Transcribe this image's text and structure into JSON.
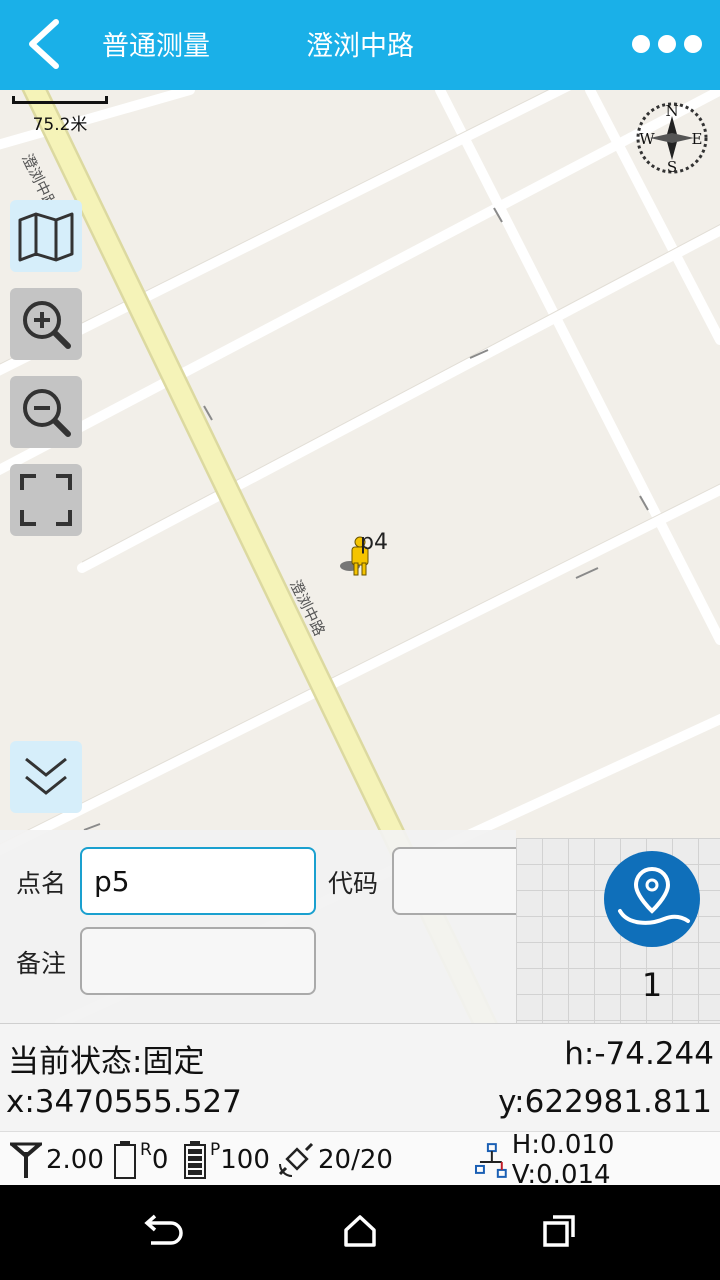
{
  "header": {
    "back_icon": "chevron-left-icon",
    "mode_title": "普通测量",
    "road_title": "澄浏中路",
    "more_icon": "more-dots-icon"
  },
  "map": {
    "scale_label": "75.2米",
    "compass": {
      "n": "N",
      "s": "S",
      "w": "W",
      "e": "E"
    },
    "road_label": "澄浏中路",
    "point_label": "p4",
    "tools": [
      {
        "name": "map-layers-icon"
      },
      {
        "name": "zoom-in-icon"
      },
      {
        "name": "zoom-out-icon"
      },
      {
        "name": "fullscreen-icon"
      },
      {
        "name": "double-chevron-down-icon"
      }
    ],
    "colors": {
      "background": "#f2efe9",
      "road_main": "#f5f3b8",
      "road_minor": "#ffffff"
    }
  },
  "form": {
    "point_name_label": "点名",
    "point_name_value": "p5",
    "code_label": "代码",
    "code_value": "",
    "note_label": "备注",
    "note_value": "",
    "survey_icon": "location-survey-icon",
    "point_count": "1"
  },
  "status": {
    "state_label": "当前状态:",
    "state_value": "固定",
    "h_label": "h:",
    "h_value": "-74.244",
    "x_label": "x:",
    "x_value": "3470555.527",
    "y_label": "y:",
    "y_value": "622981.811",
    "diff_age": "2.00",
    "r_label": "R",
    "r_value": "0",
    "p_label": "P",
    "p_value": "100",
    "satellites": "20/20",
    "precision": "H:0.010 V:0.014"
  },
  "colors": {
    "accent": "#1ab0e8",
    "button": "#0f6fba",
    "input_focus": "#1aa0cf"
  }
}
